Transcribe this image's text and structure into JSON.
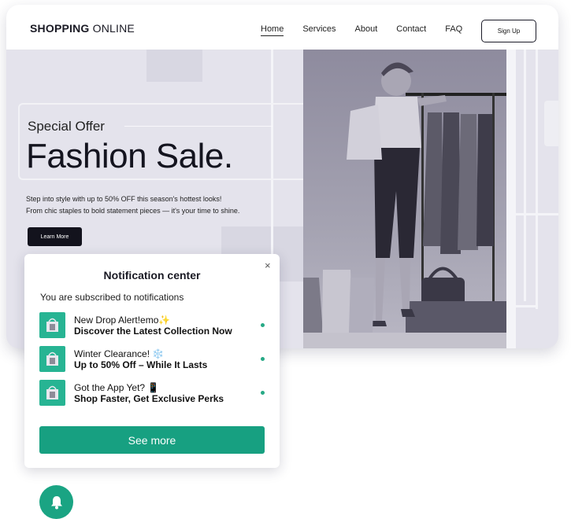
{
  "header": {
    "brand_bold": "SHOPPING",
    "brand_rest": " ONLINE",
    "nav": [
      "Home",
      "Services",
      "About",
      "Contact",
      "FAQ"
    ],
    "signup": "Sign Up"
  },
  "hero": {
    "kicker": "Special Offer",
    "headline": "Fashion Sale.",
    "desc1": "Step into style with up to 50% OFF this season's hottest looks!",
    "desc2": "From chic staples to bold statement pieces — it's your time to shine.",
    "cta": "Learn More"
  },
  "notifications": {
    "close": "×",
    "title": "Notification center",
    "subtitle": "You are subscribed to notifications",
    "items": [
      {
        "title": "New Drop Alert!emo✨",
        "body": "Discover the Latest Collection Now"
      },
      {
        "title": "Winter Clearance! ❄️",
        "body": "Up to 50% Off – While It Lasts"
      },
      {
        "title": "Got the App Yet? 📱",
        "body": "Shop Faster, Get Exclusive Perks"
      }
    ],
    "see_more": "See more"
  },
  "colors": {
    "accent": "#17a081",
    "dark": "#13131d",
    "hero_bg": "#e4e3ec"
  },
  "icons": [
    "close-icon",
    "shopping-bag-icon",
    "bell-icon"
  ]
}
